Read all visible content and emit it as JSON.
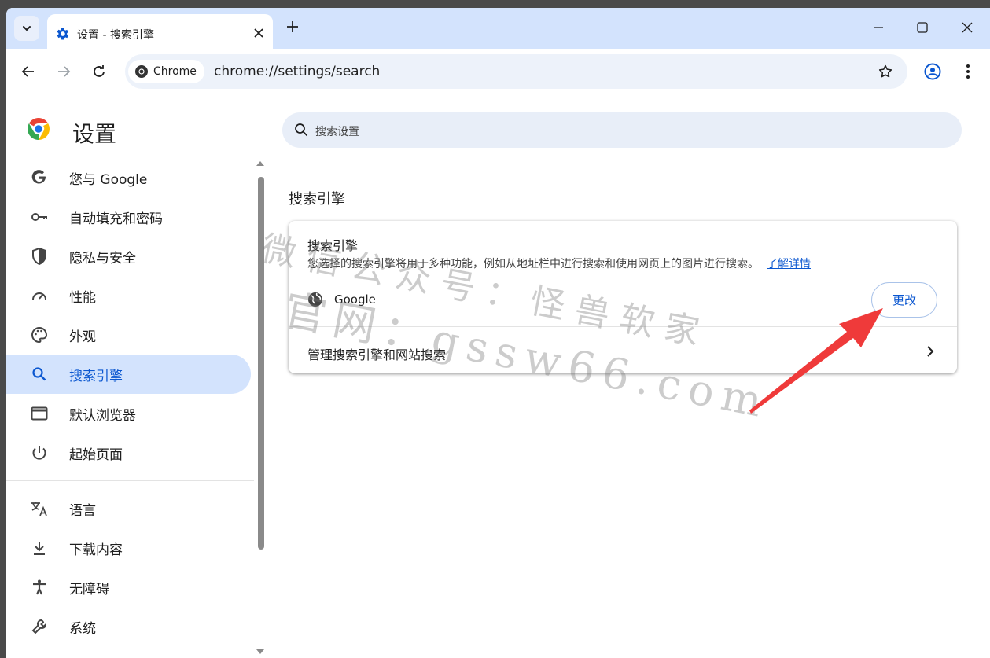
{
  "browser": {
    "tab_title": "设置 - 搜索引擎",
    "url_chip": "Chrome",
    "url_text": "chrome://settings/search",
    "accent": "#0b57d0",
    "tabbar_color": "#d3e3fd"
  },
  "settings": {
    "title": "设置",
    "search_placeholder": "搜索设置",
    "nav": [
      {
        "label": "您与 Google",
        "icon": "google-g-icon"
      },
      {
        "label": "自动填充和密码",
        "icon": "key-icon"
      },
      {
        "label": "隐私与安全",
        "icon": "shield-icon"
      },
      {
        "label": "性能",
        "icon": "speedometer-icon"
      },
      {
        "label": "外观",
        "icon": "palette-icon"
      },
      {
        "label": "搜索引擎",
        "icon": "search-icon",
        "active": true
      },
      {
        "label": "默认浏览器",
        "icon": "browser-window-icon"
      },
      {
        "label": "起始页面",
        "icon": "power-icon"
      }
    ],
    "nav_extra": [
      {
        "label": "语言",
        "icon": "translate-icon"
      },
      {
        "label": "下载内容",
        "icon": "download-icon"
      },
      {
        "label": "无障碍",
        "icon": "accessibility-icon"
      },
      {
        "label": "系统",
        "icon": "wrench-icon"
      }
    ],
    "section_title": "搜索引擎",
    "card": {
      "heading": "搜索引擎",
      "description": "您选择的搜索引擎将用于多种功能，例如从地址栏中进行搜索和使用网页上的图片进行搜索。",
      "learn_more": "了解详情",
      "engine": "Google",
      "change_button": "更改",
      "manage_label": "管理搜索引擎和网站搜索"
    }
  },
  "watermark": {
    "line1": "微信公众号：怪兽软家",
    "line2": "官网：gssw66.com"
  }
}
